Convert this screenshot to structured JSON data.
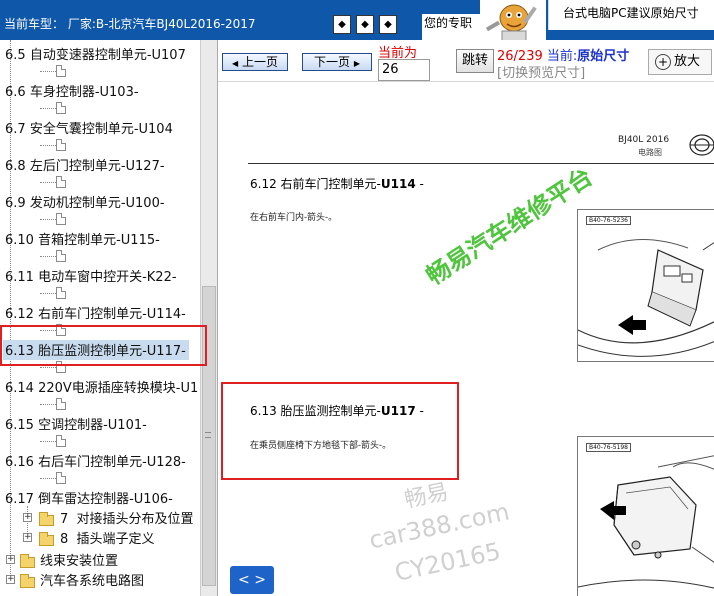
{
  "topbar": {
    "vehicle_label": "当前车型： 厂家:B-北京汽车BJ40L2016-2017",
    "nav_first": "◆",
    "nav_middle": "◆",
    "nav_last": "◆",
    "tip_text": "您的专职",
    "banner_text": "台式电脑PC建议原始尺寸"
  },
  "tree": {
    "items": [
      {
        "num": "6.5",
        "label": "自动变速器控制单元-U107"
      },
      {
        "num": "6.6",
        "label": "车身控制器-U103-"
      },
      {
        "num": "6.7",
        "label": "安全气囊控制单元-U104"
      },
      {
        "num": "6.8",
        "label": "左后门控制单元-U127-"
      },
      {
        "num": "6.9",
        "label": "发动机控制单元-U100-"
      },
      {
        "num": "6.10",
        "label": "音箱控制单元-U115-"
      },
      {
        "num": "6.11",
        "label": "电动车窗中控开关-K22-"
      },
      {
        "num": "6.12",
        "label": "右前车门控制单元-U114-"
      },
      {
        "num": "6.13",
        "label": "胎压监测控制单元-U117-"
      },
      {
        "num": "6.14",
        "label": "220V电源插座转换模块-U1"
      },
      {
        "num": "6.15",
        "label": "空调控制器-U101-"
      },
      {
        "num": "6.16",
        "label": "右后车门控制单元-U128-"
      },
      {
        "num": "6.17",
        "label": "倒车雷达控制器-U106-"
      }
    ],
    "sub_folders": [
      {
        "num": "7",
        "label": "对接插头分布及位置"
      },
      {
        "num": "8",
        "label": "插头端子定义"
      }
    ],
    "root_folders": [
      {
        "label": "线束安装位置"
      },
      {
        "label": "汽车各系统电路图"
      }
    ]
  },
  "toolbar": {
    "prev_label": "上一页",
    "next_label": "下一页",
    "current_label": "当前为",
    "page_value": "26",
    "jump_label": "跳转",
    "page_current": "26/",
    "page_total": "239",
    "current_text": "当前:",
    "current_mode": "原始尺寸",
    "switch_hint": "[切换预览尺寸]",
    "zoom_label": "放大",
    "zoom_icon": "+"
  },
  "document": {
    "model": "BJ40L 2016",
    "subtitle": "电路图",
    "section1_title_prefix": "6.12 右前车门控制单元-",
    "section1_title_code": "U114",
    "section1_title_suffix": " -",
    "section1_text": "在右前车门内-箭头-。",
    "section1_fig": "B40-76-5236",
    "section2_title_prefix": "6.13 胎压监测控制单元-",
    "section2_title_code": "U117",
    "section2_title_suffix": " -",
    "section2_text": "在乘员侧座椅下方地毯下部-箭头-。",
    "section2_fig": "B40-76-5198",
    "watermark": "畅易汽车维修平台",
    "watermark_gray_1": "畅易",
    "watermark_gray_2": "car388.com",
    "watermark_gray_3": "CY20165",
    "nav_arrows": "< >"
  }
}
